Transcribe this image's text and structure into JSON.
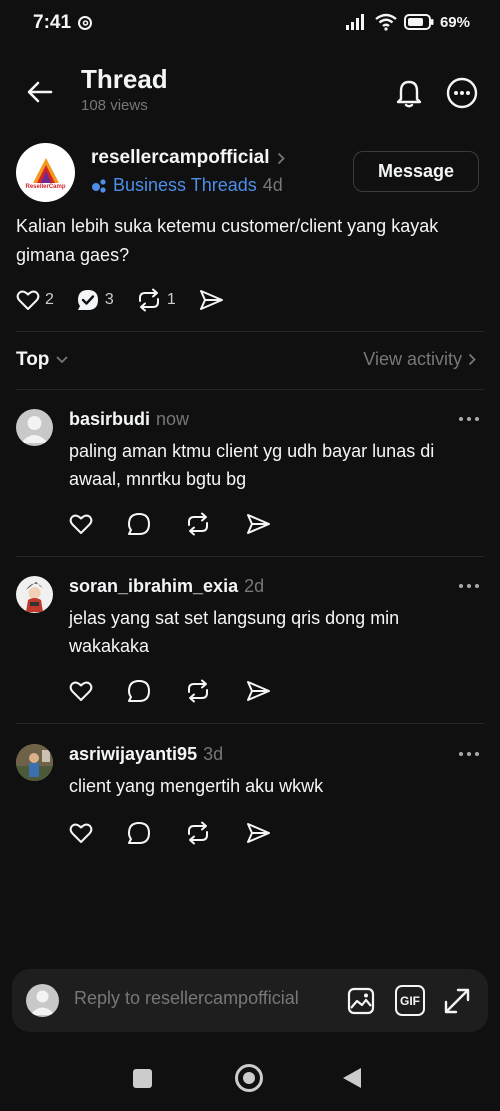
{
  "status_bar": {
    "time": "7:41",
    "battery": "69%"
  },
  "header": {
    "title": "Thread",
    "views": "108 views"
  },
  "post": {
    "username": "resellercampofficial",
    "avatar_text": "ResellerCamp",
    "topic": "Business Threads",
    "time": "4d",
    "message_label": "Message",
    "text": "Kalian lebih suka ketemu customer/client yang kayak gimana gaes?",
    "likes": "2",
    "replies": "3",
    "reposts": "1"
  },
  "sort": {
    "label": "Top",
    "view_activity": "View activity"
  },
  "comments": [
    {
      "username": "basirbudi",
      "time": "now",
      "text": "paling aman ktmu client yg udh bayar lunas di awaal, mnrtku bgtu bg"
    },
    {
      "username": "soran_ibrahim_exia",
      "time": "2d",
      "text": "jelas yang sat set langsung qris dong min wakakaka"
    },
    {
      "username": "asriwijayanti95",
      "time": "3d",
      "text": "client yang mengertih aku wkwk"
    }
  ],
  "reply": {
    "placeholder": "Reply to resellercampofficial",
    "gif_label": "GIF"
  },
  "colors": {
    "background": "#101010",
    "text": "#f3f5f7",
    "muted": "#777777",
    "topic_blue": "#4d8fe8",
    "divider": "#262626"
  }
}
